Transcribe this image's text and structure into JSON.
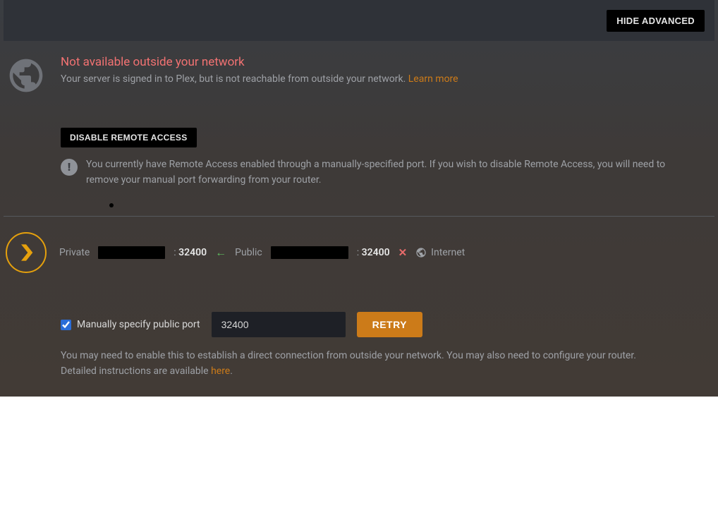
{
  "topbar": {
    "hide_advanced": "HIDE ADVANCED"
  },
  "status": {
    "title": "Not available outside your network",
    "subtitle_prefix": "Your server is signed in to Plex, but is not reachable from outside your network. ",
    "learn_more": "Learn more"
  },
  "disable": {
    "button": "DISABLE REMOTE ACCESS",
    "info": "You currently have Remote Access enabled through a manually-specified port. If you wish to disable Remote Access, you will need to remove your manual port forwarding from your router."
  },
  "connection": {
    "private_label": "Private",
    "private_port": "32400",
    "public_label": "Public",
    "public_port": "32400",
    "internet_label": "Internet"
  },
  "port_config": {
    "checkbox_label": "Manually specify public port",
    "port_value": "32400",
    "retry": "RETRY",
    "help_prefix": "You may need to enable this to establish a direct connection from outside your network. You may also need to configure your router. Detailed instructions are available ",
    "help_link": "here",
    "help_suffix": "."
  },
  "colors": {
    "accent": "#cc7b19",
    "error": "#f27272",
    "plex_gold": "#e5a00d"
  }
}
